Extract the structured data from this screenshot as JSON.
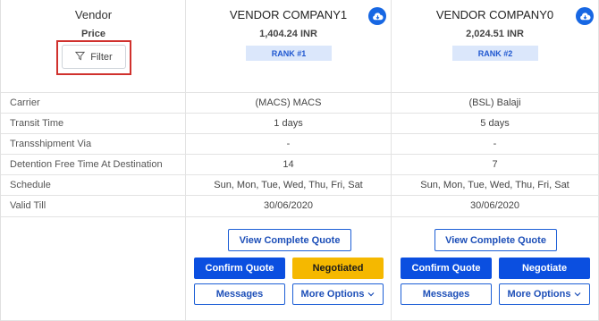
{
  "header": {
    "vendor_label": "Vendor",
    "price_label": "Price",
    "filter_label": "Filter"
  },
  "row_labels": [
    "Carrier",
    "Transit Time",
    "Transshipment Via",
    "Detention Free Time At Destination",
    "Schedule",
    "Valid Till"
  ],
  "vendors": [
    {
      "name": "VENDOR COMPANY1",
      "price": "1,404.24 INR",
      "rank": "RANK #1",
      "rows": [
        "(MACS) MACS",
        "1 days",
        "-",
        "14",
        "Sun, Mon, Tue, Wed, Thu, Fri, Sat",
        "30/06/2020"
      ],
      "view_quote": "View Complete Quote",
      "confirm": "Confirm Quote",
      "status": "Negotiated",
      "messages": "Messages",
      "more": "More Options"
    },
    {
      "name": "VENDOR COMPANY0",
      "price": "2,024.51 INR",
      "rank": "RANK #2",
      "rows": [
        "(BSL) Balaji",
        "5 days",
        "-",
        "7",
        "Sun, Mon, Tue, Wed, Thu, Fri, Sat",
        "30/06/2020"
      ],
      "view_quote": "View Complete Quote",
      "confirm": "Confirm Quote",
      "status": "Negotiate",
      "messages": "Messages",
      "more": "More Options"
    }
  ],
  "colors": {
    "primary": "#0b4fe0",
    "negotiated": "#f5b800",
    "rank_bg": "#dbe7fb",
    "highlight_border": "#d0312d"
  },
  "icons": {
    "download": "cloud-download-icon",
    "filter": "filter-icon",
    "chevron": "chevron-down-icon"
  }
}
